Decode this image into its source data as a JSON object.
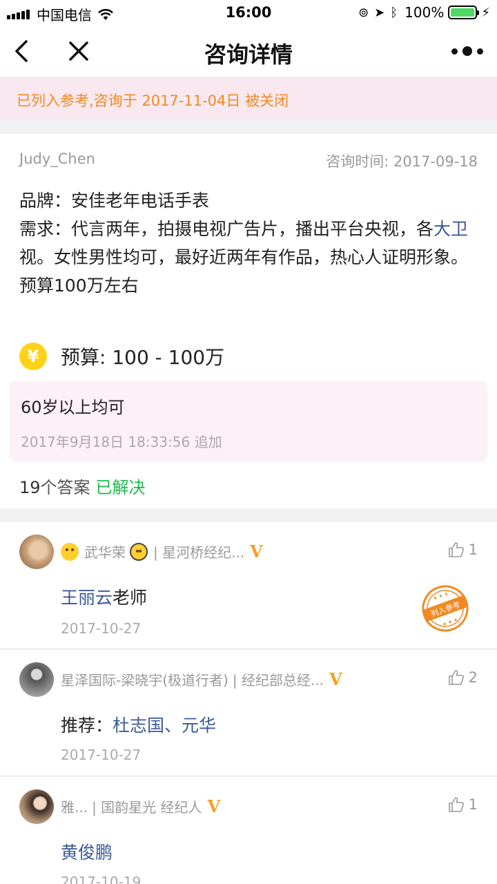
{
  "status": {
    "carrier": "中国电信",
    "time": "16:00",
    "battery": "100%"
  },
  "nav": {
    "title": "咨询详情"
  },
  "notice": "已列入参考,咨询于 2017-11-04日 被关闭",
  "question": {
    "user": "Judy_Chen",
    "time": "咨询时间: 2017-09-18",
    "line1": "品牌：安佳老年电话手表",
    "line2_pre": "需求：代言两年，拍摄电视广告片，播出平台央视，各",
    "line2_hl": "大卫",
    "line2_post": "视。女性男性均可，最好近两年有作品，热心人证明形象。",
    "line3": "预算100万左右",
    "budget": "预算: 100 - 100万",
    "addon_text": "60岁以上均可",
    "addon_time": "2017年9月18日 18:33:56 追加",
    "answer_count": "19",
    "answer_unit": "个答案",
    "solved": "已解决"
  },
  "answers": [
    {
      "author": "武华荣",
      "org": "| 星河桥经纪...",
      "likes": "1",
      "content_name": "王丽云",
      "content_suffix": "老师",
      "date": "2017-10-27",
      "stamp": "列入参考"
    },
    {
      "author": "星泽国际-梁晓宇(极道行者)",
      "org": "| 经纪部总经...",
      "likes": "2",
      "content_prefix": "推荐：",
      "content_name": "杜志国、元华",
      "date": "2017-10-27"
    },
    {
      "author": "雅...",
      "org": "| 国韵星光 经纪人",
      "likes": "1",
      "content_name": "黄俊鹏",
      "date": "2017-10-19"
    }
  ],
  "colors": {
    "accent_orange": "#f08a22",
    "link_blue": "#3b5998",
    "solved_green": "#1fb84a",
    "notice_bg": "#f9e8f0"
  }
}
